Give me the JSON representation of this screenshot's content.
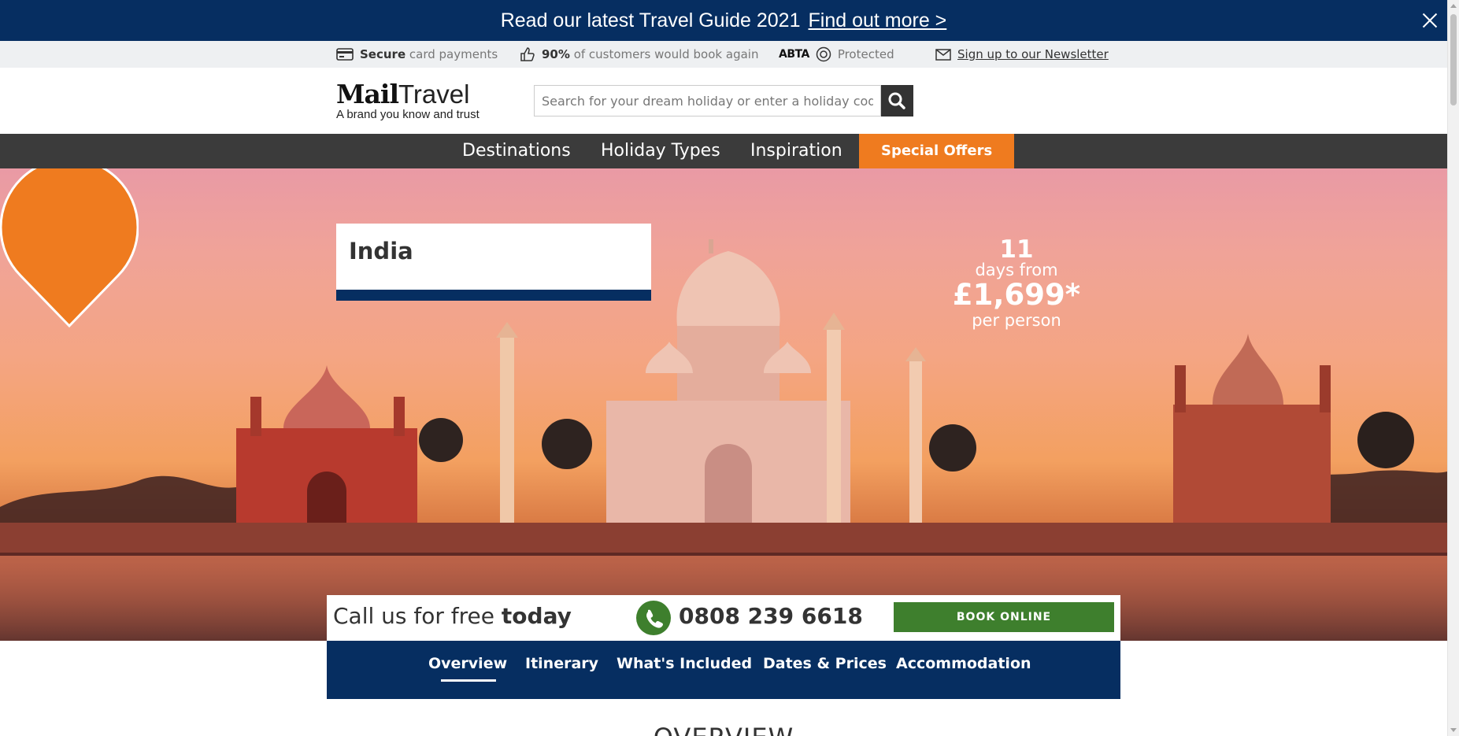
{
  "promo": {
    "text": "Read our latest Travel Guide 2021",
    "link": "Find out more >"
  },
  "trust": {
    "secure_strong": "Secure",
    "secure_rest": "card payments",
    "customers_strong": "90%",
    "customers_rest": "of customers would book again",
    "abta": "ABTA",
    "protected": "Protected",
    "newsletter": "Sign up to our Newsletter"
  },
  "logo": {
    "brand_bold": "Mail",
    "brand_light": "Travel",
    "tagline": "A brand you know and trust"
  },
  "search": {
    "placeholder": "Search for your dream holiday or enter a holiday code"
  },
  "nav": {
    "items": [
      "Destinations",
      "Holiday Types",
      "Inspiration"
    ],
    "offers": "Special Offers"
  },
  "hero": {
    "title": "India",
    "price": {
      "days": "11",
      "days_label": "days from",
      "amount": "£1,699*",
      "per": "per person"
    }
  },
  "callbar": {
    "call_prefix": "Call us for free",
    "call_strong": "today",
    "phone": "0808 239 6618",
    "book": "BOOK ONLINE"
  },
  "tabs": [
    "Overview",
    "Itinerary",
    "What's Included",
    "Dates & Prices",
    "Accommodation"
  ],
  "section_heading": "OVERVIEW",
  "colors": {
    "navy": "#062e61",
    "orange": "#ef7b1f",
    "green": "#3e7f2d",
    "nav_bg": "#3b3b3b"
  }
}
